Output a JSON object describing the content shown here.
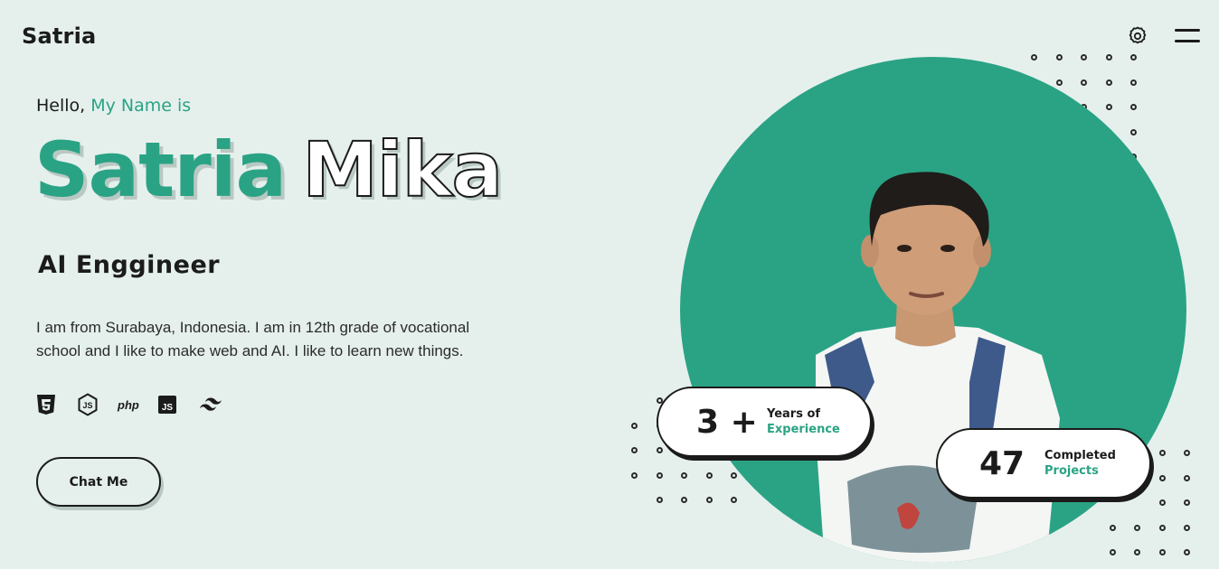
{
  "header": {
    "logo": "Satria",
    "settings_icon": "gear-icon",
    "menu_icon": "hamburger-menu-icon"
  },
  "hero": {
    "greeting": "Hello,",
    "greeting_accent": "My Name is",
    "first_name": "Satria",
    "last_name": "Mika",
    "role": "AI Enggineer",
    "bio": "I am from Surabaya, Indonesia. I am in 12th grade of vocational school and I like to make web and AI. I like to learn new things.",
    "tech_icons": [
      "html5-icon",
      "nodejs-icon",
      "php-icon",
      "javascript-icon",
      "tailwind-icon"
    ],
    "php_label": "php",
    "js_label": "JS",
    "cta_label": "Chat Me"
  },
  "stats": {
    "years": {
      "value": "3 +",
      "label_line1": "Years of",
      "label_line2": "Experience"
    },
    "projects": {
      "value": "47",
      "label_line1": "Completed",
      "label_line2": "Projects"
    }
  },
  "colors": {
    "accent": "#2aa384",
    "background": "#e5f0ed",
    "text": "#1b1b1b"
  }
}
